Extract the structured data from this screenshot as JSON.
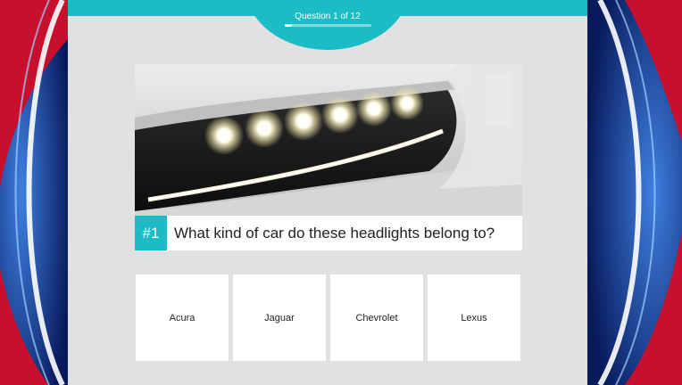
{
  "quiz": {
    "progress": {
      "label": "Question 1 of 12",
      "current": 1,
      "total": 12
    },
    "question": {
      "number": "#1",
      "text": "What kind of car do these headlights belong to?"
    },
    "answers": [
      "Acura",
      "Jaguar",
      "Chevrolet",
      "Lexus"
    ]
  },
  "colors": {
    "accent": "#1cbcc6",
    "panel": "#e1e1e1",
    "backdrop_blue": "#0b1f6a",
    "backdrop_red": "#c8102e"
  },
  "icons": [
    "car-headlight-photo"
  ]
}
